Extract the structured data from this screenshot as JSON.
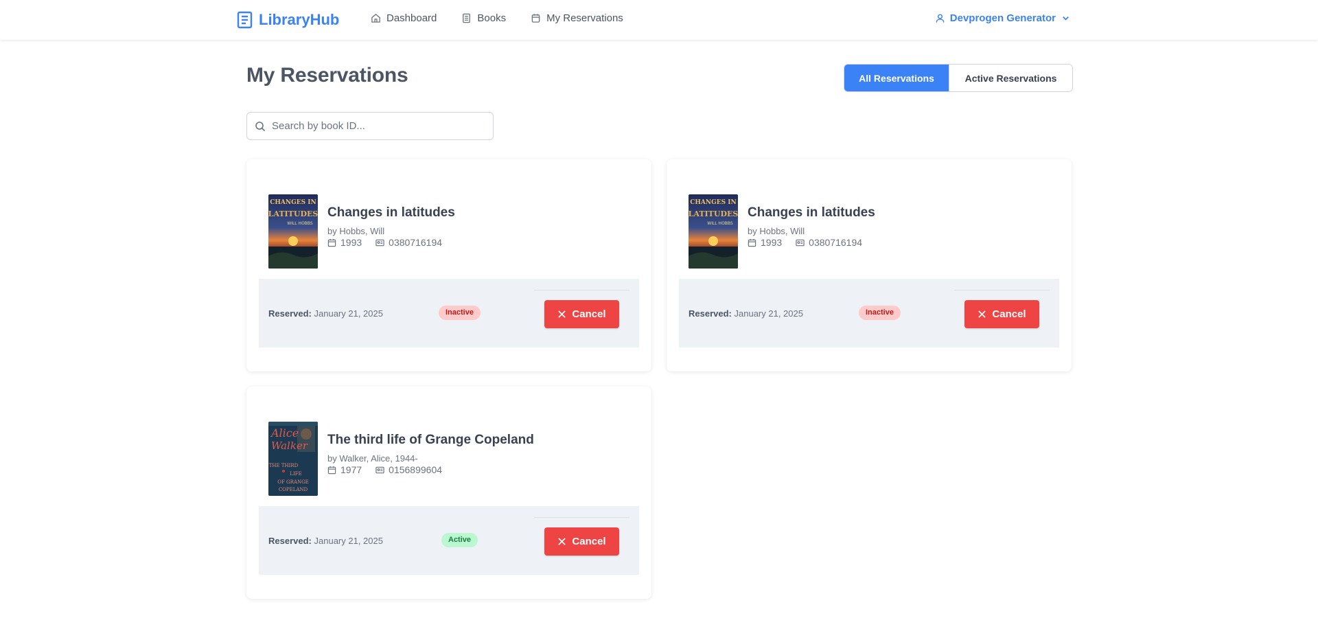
{
  "nav": {
    "brand": "LibraryHub",
    "links": [
      {
        "label": "Dashboard",
        "icon": "home-icon"
      },
      {
        "label": "Books",
        "icon": "book-icon"
      },
      {
        "label": "My Reservations",
        "icon": "calendar-icon"
      }
    ],
    "user": "Devprogen Generator"
  },
  "page": {
    "title": "My Reservations",
    "filters": {
      "all": "All Reservations",
      "active": "Active Reservations",
      "selected": "All Reservations"
    },
    "search_placeholder": "Search by book ID..."
  },
  "reservations": [
    {
      "title": "Changes in latitudes",
      "author": "by Hobbs, Will",
      "year": "1993",
      "isbn": "0380716194",
      "reserved_label": "Reserved:",
      "reserved_date": "January 21, 2025",
      "status": "Inactive",
      "action": "Cancel",
      "cover_text": [
        "CHANGES IN",
        "LATITUDES",
        "WILL HOBBS"
      ]
    },
    {
      "title": "Changes in latitudes",
      "author": "by Hobbs, Will",
      "year": "1993",
      "isbn": "0380716194",
      "reserved_label": "Reserved:",
      "reserved_date": "January 21, 2025",
      "status": "Inactive",
      "action": "Cancel",
      "cover_text": [
        "CHANGES IN",
        "LATITUDES",
        "WILL HOBBS"
      ]
    },
    {
      "title": "The third life of Grange Copeland",
      "author": "by Walker, Alice, 1944-",
      "year": "1977",
      "isbn": "0156899604",
      "reserved_label": "Reserved:",
      "reserved_date": "January 21, 2025",
      "status": "Active",
      "action": "Cancel",
      "cover_text": [
        "Alice",
        "Walker",
        "THE THIRD",
        "LIFE",
        "OF GRANGE",
        "COPELAND"
      ]
    }
  ],
  "colors": {
    "primary": "#3b82f6",
    "danger": "#ef4444",
    "inactive_badge_bg": "#fecaca",
    "active_badge_bg": "#bbf7d0",
    "footer_bg": "#eef1f6"
  }
}
